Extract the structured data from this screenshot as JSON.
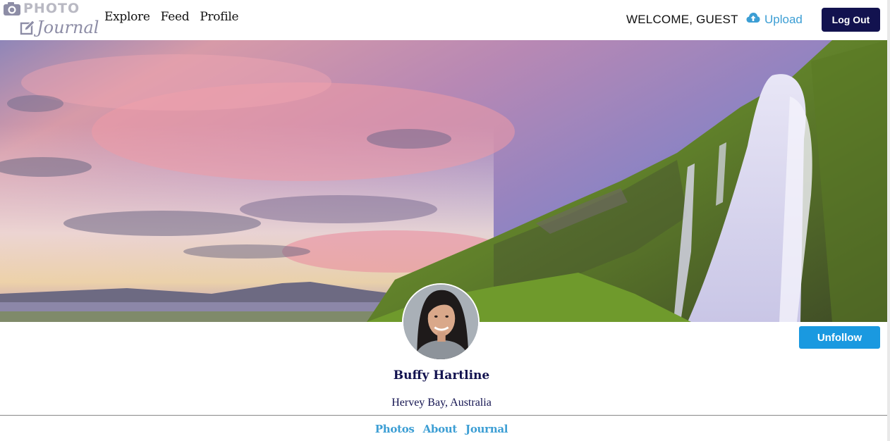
{
  "header": {
    "logo_top": "PHOTO",
    "logo_bottom": "Journal",
    "nav": [
      {
        "label": "Explore"
      },
      {
        "label": "Feed"
      },
      {
        "label": "Profile"
      }
    ],
    "welcome": "WELCOME, GUEST",
    "upload_label": "Upload",
    "logout_label": "Log Out"
  },
  "profile": {
    "name": "Buffy Hartline",
    "location": "Hervey Bay, Australia",
    "follow_button": "Unfollow",
    "tabs": [
      {
        "label": "Photos"
      },
      {
        "label": "About"
      },
      {
        "label": "Journal"
      }
    ]
  },
  "colors": {
    "navy": "#12124f",
    "accent_blue": "#1a99e0",
    "link_blue": "#3c9ed4"
  },
  "icons": {
    "logo_camera": "camera-icon",
    "logo_pen": "pencil-edit-icon",
    "upload": "cloud-upload-icon"
  }
}
